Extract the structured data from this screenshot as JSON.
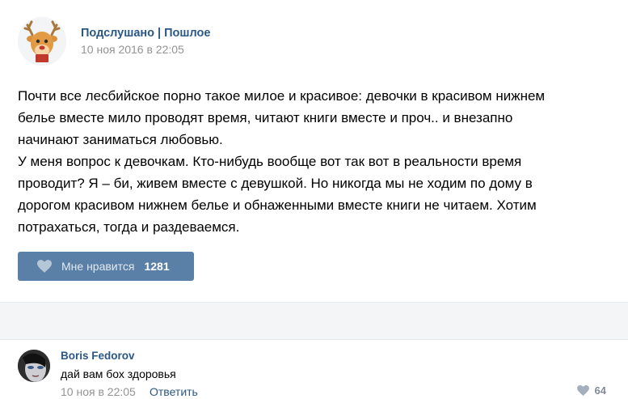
{
  "post": {
    "group_name": "Подслушано | Пошлое",
    "date": "10 ноя 2016 в 22:05",
    "text_lines": [
      "Почти все лесбийское порно такое милое и красивое: девочки в красивом нижнем",
      "белье вместе мило проводят время, читают книги вместе и проч.. и внезапно",
      "начинают заниматься любовью.",
      "У меня вопрос к девочкам. Кто-нибудь вообще вот так вот в реальности время",
      "проводит? Я – би, живем вместе с девушкой. Но никогда мы не ходим по дому в",
      "дорогом красивом нижнем белье и обнаженными вместе книги не читаем. Хотим",
      "потрахаться, тогда и раздеваемся."
    ],
    "like_label": "Мне нравится",
    "like_count": "1281"
  },
  "comment": {
    "author": "Boris Fedorov",
    "text": "дай вам бох здоровья",
    "date": "10 ноя в 22:05",
    "reply_label": "Ответить",
    "like_count": "64"
  },
  "colors": {
    "link": "#2a5885",
    "like_button": "#5b80a7",
    "muted": "#939393",
    "band": "#f4f5f7"
  },
  "icons": {
    "group_avatar": "deer-avatar",
    "like": "heart-icon",
    "comment_like": "heart-icon"
  }
}
